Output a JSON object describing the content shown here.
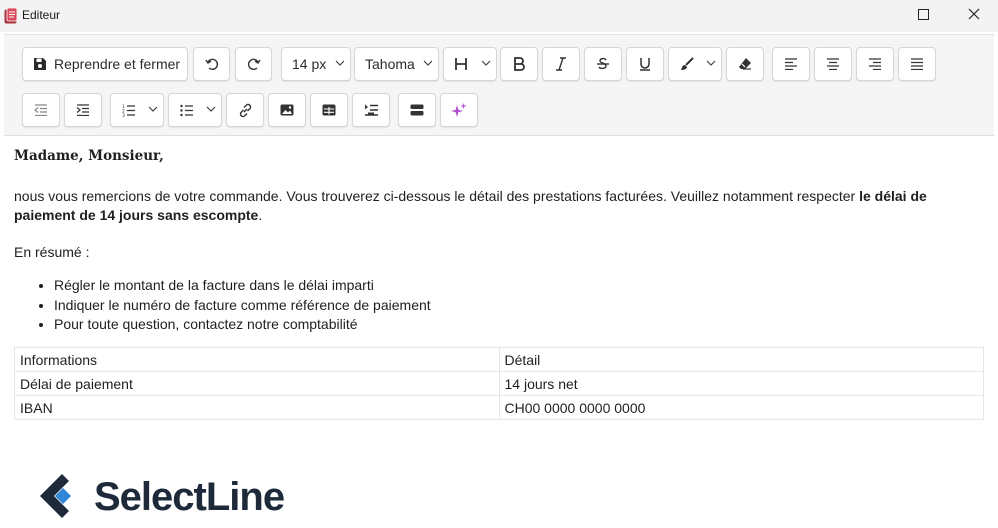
{
  "window": {
    "title": "Editeur",
    "icons": {
      "app": "app-document-icon",
      "maximize": "maximize-icon",
      "close": "close-icon"
    }
  },
  "toolbar": {
    "save_close_label": "Reprendre et fermer",
    "font_size": "14 px",
    "font_family": "Tahoma",
    "buttons": [
      "save-icon",
      "undo-icon",
      "redo-icon",
      "heading-icon",
      "bold-icon",
      "italic-icon",
      "strikethrough-icon",
      "underline-icon",
      "brush-icon",
      "eraser-icon",
      "align-left-icon",
      "align-center-icon",
      "align-right-icon",
      "align-justify-icon",
      "outdent-icon",
      "indent-icon",
      "ordered-list-icon",
      "bullet-list-icon",
      "link-icon",
      "image-icon",
      "table-icon",
      "list-add-icon",
      "horizontal-rule-icon",
      "ai-sparkle-icon"
    ],
    "accent_color": "#b04fd0"
  },
  "content": {
    "greeting": "Madame, Monsieur,",
    "para_start": "nous vous remercions de votre commande. Vous trouverez ci-dessous le détail des prestations facturées. Veuillez notamment respecter ",
    "para_bold": "le délai de paiement de 14 jours sans escompte",
    "para_end": ".",
    "summary": "En résumé :",
    "bullets": [
      "Régler le montant de la facture dans le délai imparti",
      "Indiquer le numéro de facture comme référence de paiement",
      "Pour toute question, contactez notre comptabilité"
    ],
    "table": [
      [
        "Informations",
        "Détail"
      ],
      [
        "Délai de paiement",
        "14 jours net"
      ],
      [
        "IBAN",
        "CH00 0000 0000 0000"
      ]
    ],
    "logo_text": "SelectLine",
    "logo_colors": {
      "dark": "#1e2a3a",
      "blue": "#2f86d6"
    }
  }
}
